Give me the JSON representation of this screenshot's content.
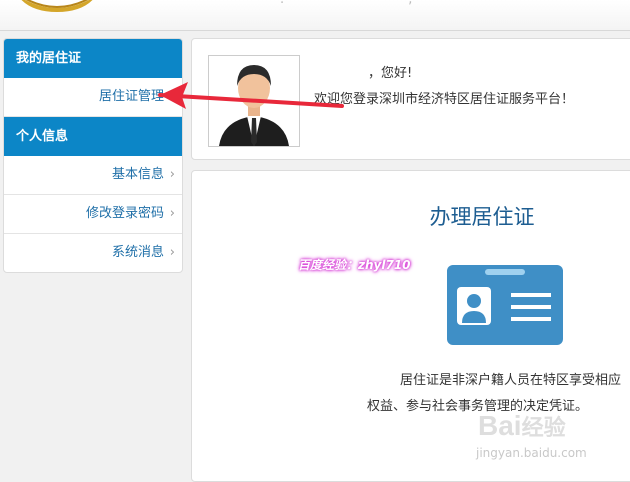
{
  "sidebar": {
    "section1_title": "我的居住证",
    "section1_items": [
      {
        "label": "居住证管理"
      }
    ],
    "section2_title": "个人信息",
    "section2_items": [
      {
        "label": "基本信息"
      },
      {
        "label": "修改登录密码"
      },
      {
        "label": "系统消息"
      }
    ]
  },
  "greeting": {
    "hello": "，您好!",
    "welcome": "欢迎您登录深圳市经济特区居住证服务平台！"
  },
  "card": {
    "title": "办理居住证",
    "desc_line1": "居住证是非深户籍人员在特区享受相应",
    "desc_line2": "权益、参与社会事务管理的决定凭证。"
  },
  "watermark": {
    "experience": "百度经验：zhyl710",
    "baidu_brand": "Bai",
    "baidu_brand2": "经验",
    "baidu_url": "jingyan.baidu.com"
  },
  "colors": {
    "accent": "#0c86c7",
    "link": "#1f6fa8",
    "title": "#1d5d91",
    "arrow": "#e8283a"
  }
}
